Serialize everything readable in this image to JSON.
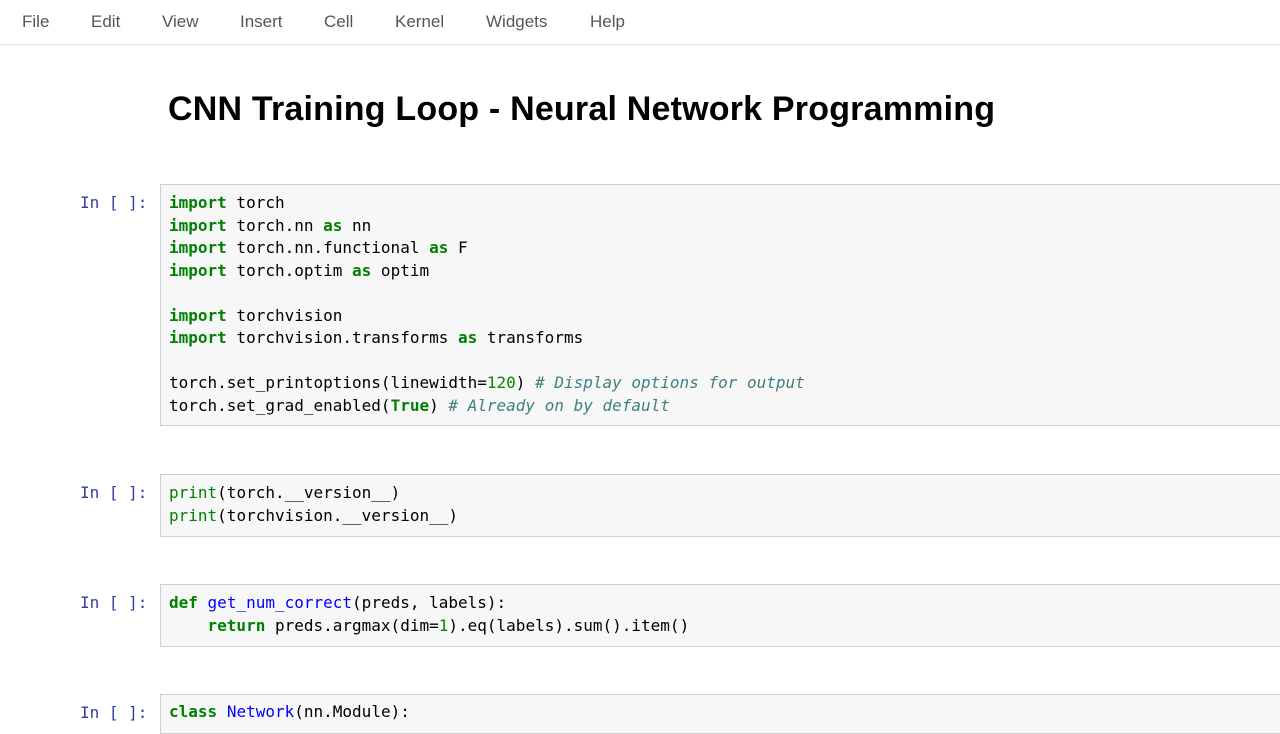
{
  "menu": [
    "File",
    "Edit",
    "View",
    "Insert",
    "Cell",
    "Kernel",
    "Widgets",
    "Help"
  ],
  "title": "CNN Training Loop - Neural Network Programming",
  "prompt": "In [ ]:",
  "cells": [
    {
      "lines": [
        "import torch",
        "import torch.nn as nn",
        "import torch.nn.functional as F",
        "import torch.optim as optim",
        "",
        "import torchvision",
        "import torchvision.transforms as transforms",
        "",
        "torch.set_printoptions(linewidth=120) # Display options for output",
        "torch.set_grad_enabled(True) # Already on by default"
      ]
    },
    {
      "lines": [
        "print(torch.__version__)",
        "print(torchvision.__version__)"
      ]
    },
    {
      "lines": [
        "def get_num_correct(preds, labels):",
        "    return preds.argmax(dim=1).eq(labels).sum().item()"
      ]
    },
    {
      "lines": [
        "class Network(nn.Module):"
      ]
    }
  ]
}
